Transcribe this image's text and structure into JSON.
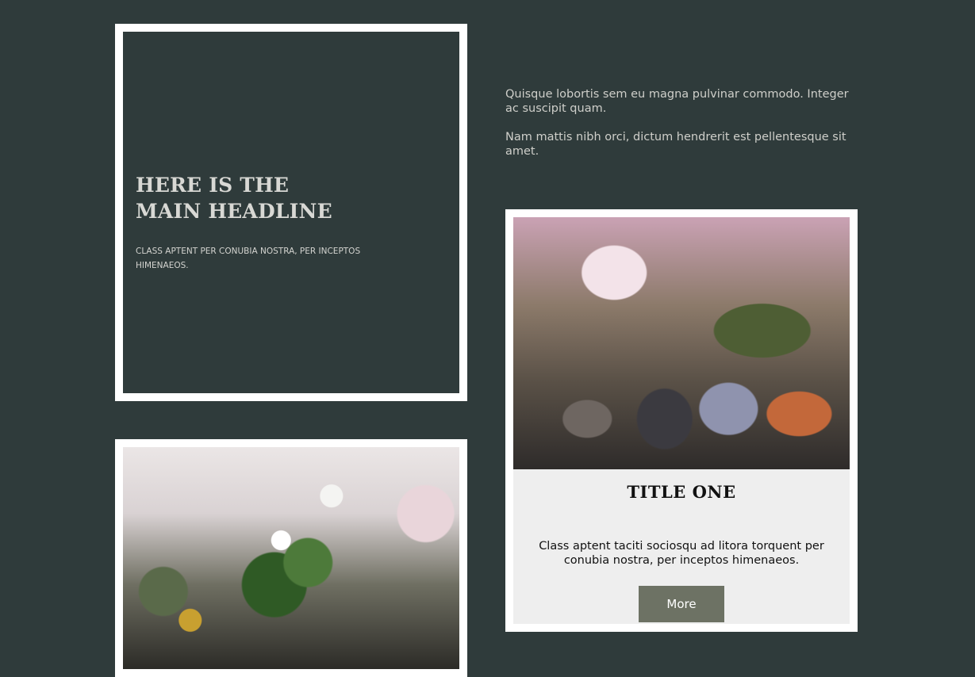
{
  "hero": {
    "title": "HERE IS THE\nMAIN HEADLINE",
    "subtitle": "CLASS APTENT PER CONUBIA NOSTRA, PER INCEPTOS HIMENAEOS."
  },
  "intro": {
    "paragraphs": [
      "Quisque lobortis sem eu magna pulvinar commodo. Integer ac suscipit quam.",
      "Nam mattis nibh orci, dictum hendrerit est pellentesque sit amet."
    ]
  },
  "card": {
    "title": "TITLE ONE",
    "description": "Class aptent taciti sociosqu ad litora torquent per conubia nostra, per inceptos himenaeos.",
    "button_label": "More"
  }
}
